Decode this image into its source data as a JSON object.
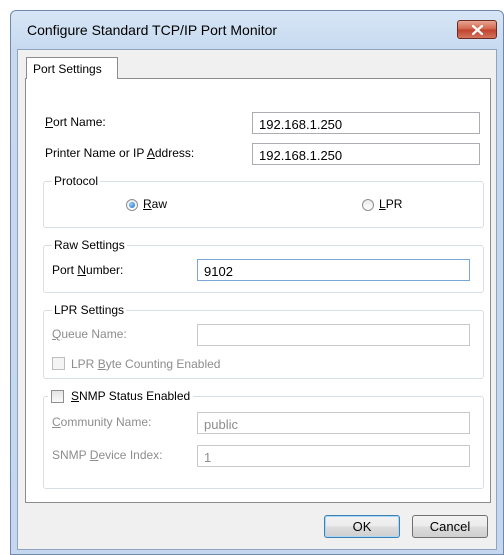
{
  "window": {
    "title": "Configure Standard TCP/IP Port Monitor"
  },
  "tabs": [
    {
      "label": "Port Settings",
      "selected": true
    }
  ],
  "port_name": {
    "label_pre": "",
    "label_key": "P",
    "label_post": "ort Name:",
    "value": "192.168.1.250"
  },
  "printer_address": {
    "label_pre": "Printer Name or IP ",
    "label_key": "A",
    "label_post": "ddress:",
    "value": "192.168.1.250"
  },
  "protocol": {
    "title": "Protocol",
    "raw": {
      "label_pre": "",
      "label_key": "R",
      "label_post": "aw",
      "checked": true
    },
    "lpr": {
      "label_pre": "",
      "label_key": "L",
      "label_post": "PR",
      "checked": false
    }
  },
  "raw_settings": {
    "title": "Raw Settings",
    "port_number": {
      "label_pre": "Port ",
      "label_key": "N",
      "label_post": "umber:",
      "value": "9102"
    }
  },
  "lpr_settings": {
    "title": "LPR Settings",
    "queue_name": {
      "label_pre": "",
      "label_key": "Q",
      "label_post": "ueue Name:",
      "value": ""
    },
    "byte_counting": {
      "label_pre": "LPR ",
      "label_key": "B",
      "label_post": "yte Counting Enabled",
      "checked": false
    }
  },
  "snmp": {
    "enabled": {
      "label_pre": "",
      "label_key": "S",
      "label_post": "NMP Status Enabled",
      "checked": false
    },
    "community_name": {
      "label_pre": "",
      "label_key": "C",
      "label_post": "ommunity Name:",
      "value": "public"
    },
    "device_index": {
      "label_pre": "SNMP ",
      "label_key": "D",
      "label_post": "evice Index:",
      "value": "1"
    }
  },
  "buttons": {
    "ok": "OK",
    "cancel": "Cancel"
  }
}
